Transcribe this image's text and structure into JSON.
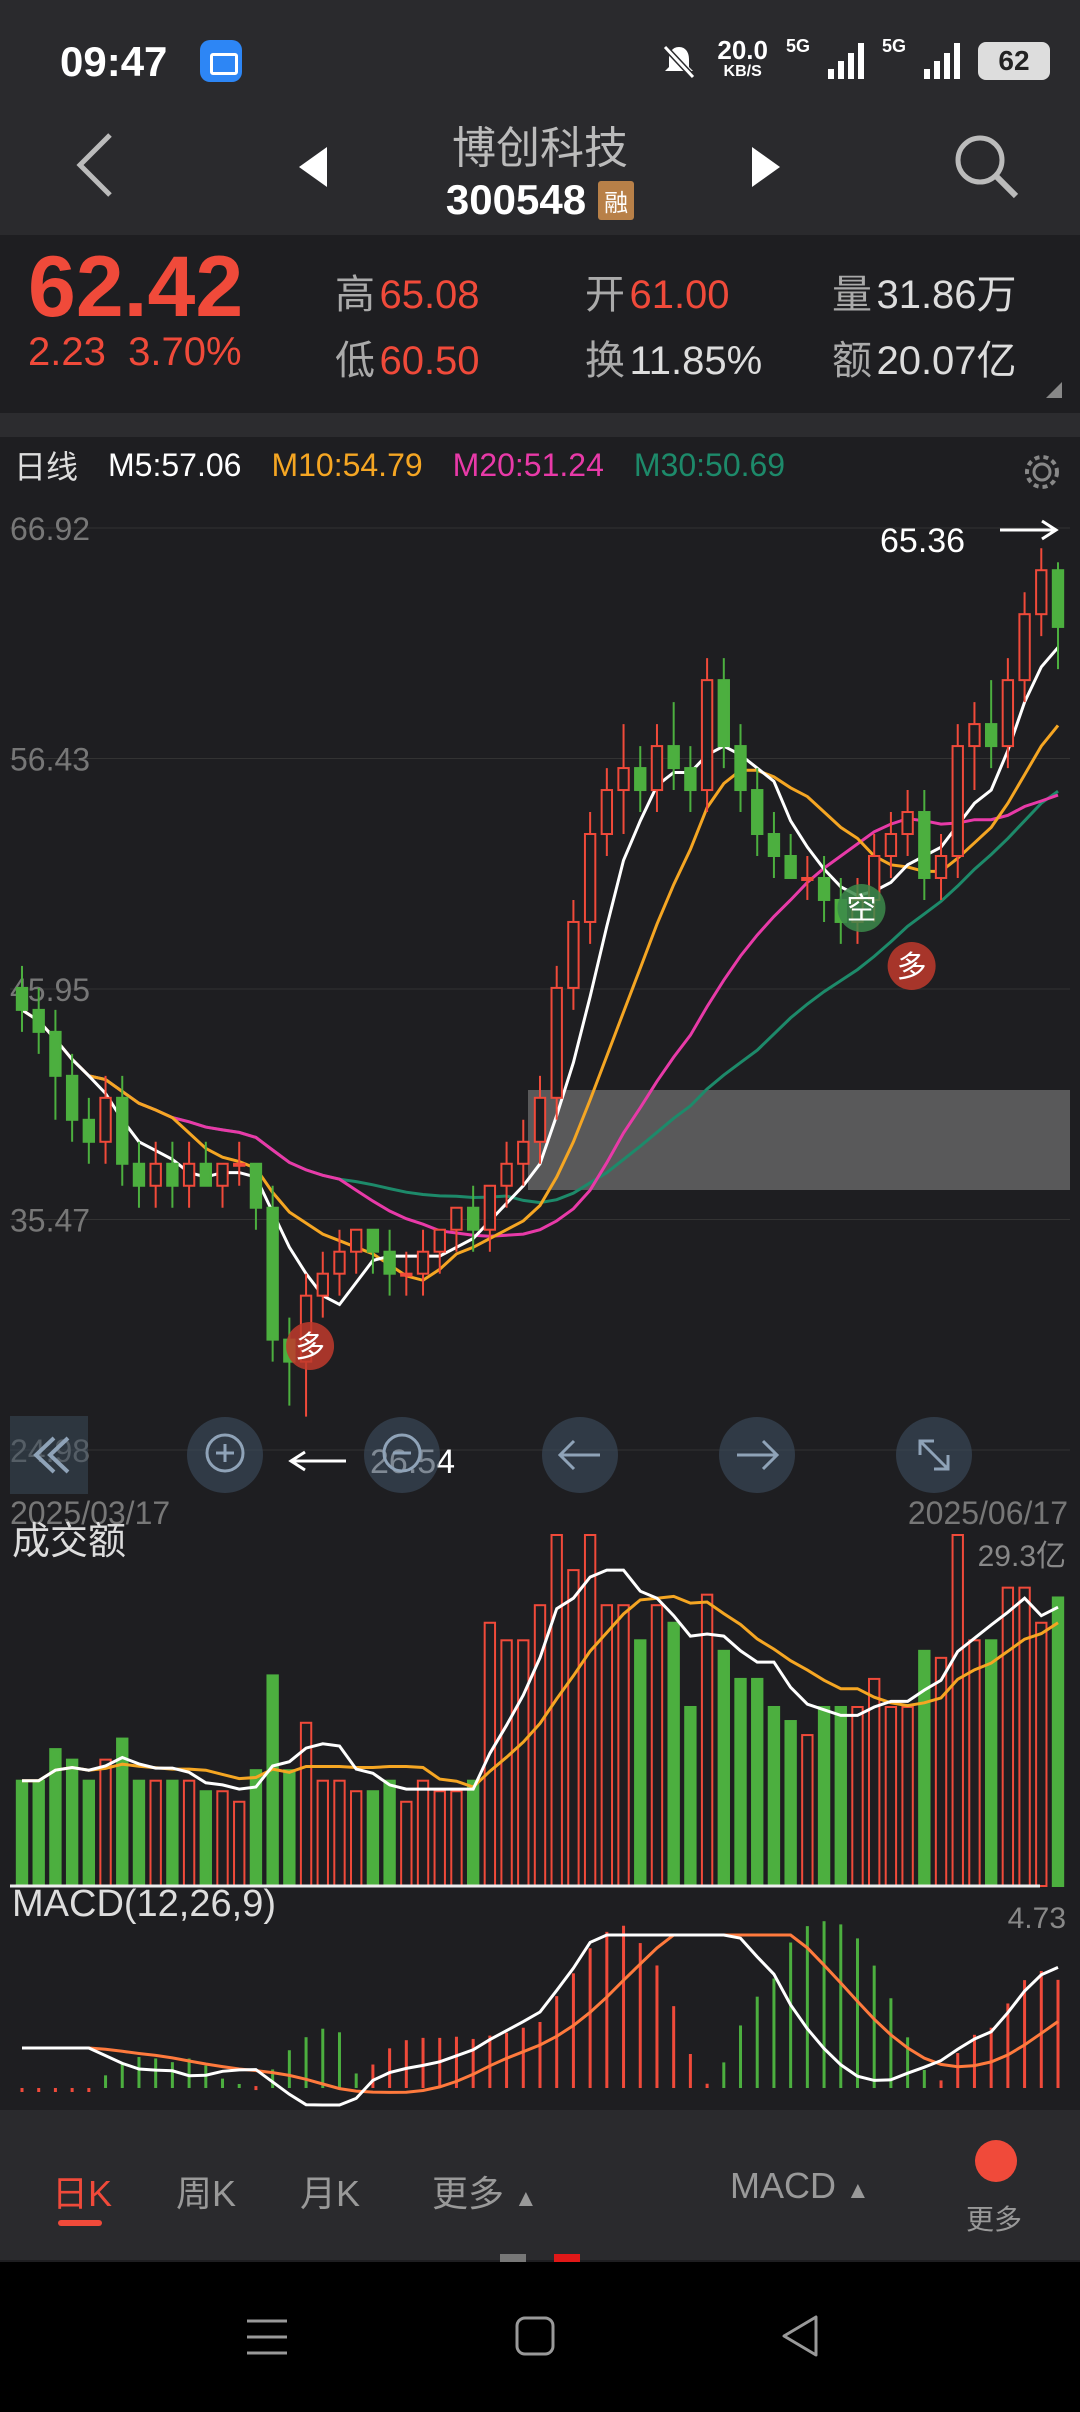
{
  "status_bar": {
    "time": "09:47",
    "net_speed": "20.0",
    "net_unit": "KB/S",
    "net_type_1": "5G",
    "net_type_2": "5G",
    "battery": "62"
  },
  "header": {
    "stock_name": "博创科技",
    "stock_code": "300548",
    "badge": "融"
  },
  "quote": {
    "price": "62.42",
    "change": "2.23",
    "change_pct": "3.70%",
    "high_label": "高",
    "high": "65.08",
    "low_label": "低",
    "low": "60.50",
    "open_label": "开",
    "open": "61.00",
    "turnover_label": "换",
    "turnover": "11.85%",
    "volume_label": "量",
    "volume": "31.86万",
    "amount_label": "额",
    "amount": "20.07亿"
  },
  "ma": {
    "period": "日线",
    "m5": "M5:57.06",
    "m10": "M10:54.79",
    "m20": "M20:51.24",
    "m30": "M30:50.69"
  },
  "colors": {
    "up": "#f04a3a",
    "down": "#4caf3f",
    "m5": "#ffffff",
    "m10": "#f5a623",
    "m20": "#e83aa8",
    "m30": "#1d8a6a"
  },
  "chart_data": [
    {
      "type": "candlestick",
      "y_ticks": [
        "66.92",
        "56.43",
        "45.95",
        "35.47",
        "24.98"
      ],
      "ylim": [
        24.98,
        66.92
      ],
      "x_start": "2025/03/17",
      "x_end": "2025/06/17",
      "high_marker": "65.36",
      "low_marker": "26.54",
      "signals": [
        "多",
        "空",
        "多"
      ],
      "candles": [
        [
          46,
          47,
          44,
          45
        ],
        [
          45,
          46,
          43,
          44
        ],
        [
          44,
          45,
          40,
          42
        ],
        [
          42,
          43,
          39,
          40
        ],
        [
          40,
          41,
          38,
          39
        ],
        [
          39,
          42,
          38,
          41
        ],
        [
          41,
          42,
          37,
          38
        ],
        [
          38,
          39,
          36,
          37
        ],
        [
          37,
          39,
          36,
          38
        ],
        [
          38,
          39,
          36,
          37
        ],
        [
          37,
          39,
          36,
          38
        ],
        [
          38,
          39,
          37,
          37
        ],
        [
          37,
          38,
          36,
          38
        ],
        [
          38,
          39,
          37,
          38
        ],
        [
          38,
          38,
          35,
          36
        ],
        [
          36,
          37,
          29,
          30
        ],
        [
          30,
          31,
          27,
          29
        ],
        [
          29,
          33,
          26.5,
          32
        ],
        [
          32,
          34,
          31,
          33
        ],
        [
          33,
          35,
          32,
          34
        ],
        [
          34,
          35,
          33,
          35
        ],
        [
          35,
          35,
          33,
          34
        ],
        [
          34,
          35,
          32,
          33
        ],
        [
          33,
          34,
          32,
          33
        ],
        [
          33,
          35,
          32,
          34
        ],
        [
          34,
          35,
          33,
          35
        ],
        [
          35,
          36,
          34,
          36
        ],
        [
          36,
          37,
          34,
          35
        ],
        [
          35,
          37,
          34,
          37
        ],
        [
          37,
          39,
          36,
          38
        ],
        [
          38,
          40,
          37,
          39
        ],
        [
          39,
          42,
          38,
          41
        ],
        [
          41,
          47,
          40,
          46
        ],
        [
          46,
          50,
          45,
          49
        ],
        [
          49,
          54,
          48,
          53
        ],
        [
          53,
          56,
          52,
          55
        ],
        [
          55,
          58,
          53,
          56
        ],
        [
          56,
          57,
          54,
          55
        ],
        [
          55,
          58,
          54,
          57
        ],
        [
          57,
          59,
          55,
          56
        ],
        [
          56,
          57,
          54,
          55
        ],
        [
          55,
          61,
          54,
          60
        ],
        [
          60,
          61,
          56,
          57
        ],
        [
          57,
          58,
          54,
          55
        ],
        [
          55,
          56,
          52,
          53
        ],
        [
          53,
          54,
          51,
          52
        ],
        [
          52,
          53,
          51,
          51
        ],
        [
          51,
          52,
          50,
          51
        ],
        [
          51,
          52,
          49,
          50
        ],
        [
          50,
          51,
          48,
          49
        ],
        [
          49,
          51,
          48,
          50
        ],
        [
          50,
          53,
          49,
          52
        ],
        [
          52,
          54,
          51,
          53
        ],
        [
          53,
          55,
          52,
          54
        ],
        [
          54,
          55,
          50,
          51
        ],
        [
          51,
          53,
          50,
          52
        ],
        [
          52,
          58,
          51,
          57
        ],
        [
          57,
          59,
          55,
          58
        ],
        [
          58,
          60,
          56,
          57
        ],
        [
          57,
          61,
          56,
          60
        ],
        [
          60,
          64,
          59,
          63
        ],
        [
          63,
          66,
          62,
          65
        ],
        [
          65,
          65.36,
          60.5,
          62.42
        ]
      ]
    },
    {
      "type": "bar",
      "title": "成交额",
      "y_max_label": "29.3亿"
    },
    {
      "type": "bar",
      "title": "MACD(12,26,9)",
      "y_max_label": "4.73"
    }
  ],
  "chart_tools": [
    "zoom-in",
    "zoom-out",
    "pan-left",
    "pan-right",
    "fullscreen"
  ],
  "tabs": {
    "daily": "日K",
    "weekly": "周K",
    "monthly": "月K",
    "more": "更多",
    "indicator": "MACD",
    "more_btn": "更多"
  }
}
